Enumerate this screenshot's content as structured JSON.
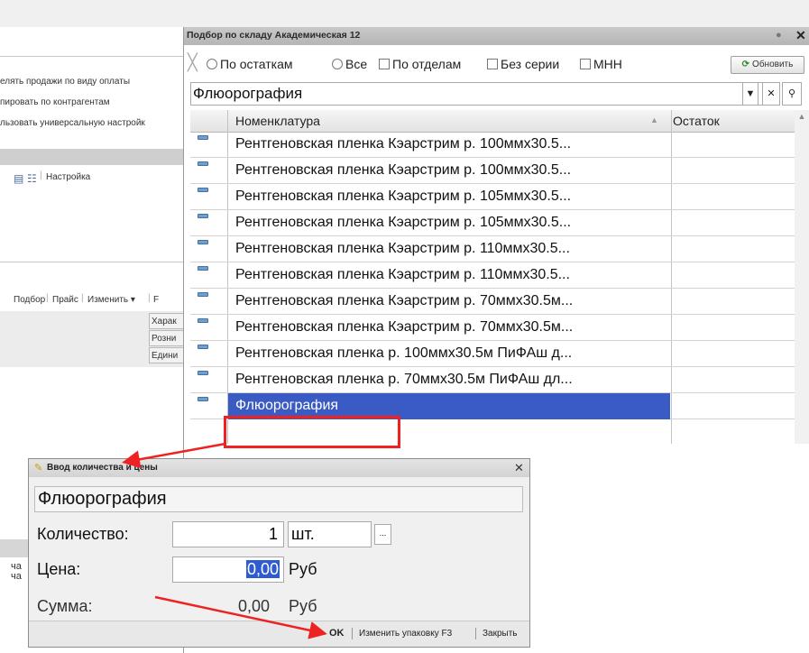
{
  "left_panel": {
    "options": [
      "елять продажи по виду оплаты",
      "пировать по контрагентам",
      "льзовать универсальную настройк"
    ],
    "toolbar_label": "Настройка",
    "toolbar2": {
      "picker": "Подбор",
      "price": "Прайс",
      "change": "Изменить ▾",
      "cut": "F"
    },
    "col_headers": [
      "Харак",
      "Розни",
      "Едини"
    ],
    "bottom_labels": [
      "ча",
      "ча"
    ]
  },
  "picker": {
    "title": "Подбор по складу Академическая 12",
    "pin_icon": "pin-icon",
    "close_glyph": "✕",
    "filters": {
      "by_stock": "По остаткам",
      "all": "Все",
      "by_department": "По отделам",
      "no_series": "Без серии",
      "mnn": "МНН"
    },
    "refresh_label": "Обновить",
    "search_value": "Флюорография",
    "columns": {
      "name": "Номенклатура",
      "rest": "Остаток"
    },
    "rows": [
      {
        "name": "Рентгеновская пленка Кэарстрим р. 100ммx30.5..."
      },
      {
        "name": "Рентгеновская пленка Кэарстрим р. 100ммx30.5..."
      },
      {
        "name": "Рентгеновская пленка Кэарстрим р. 105ммx30.5..."
      },
      {
        "name": "Рентгеновская пленка Кэарстрим р. 105ммx30.5..."
      },
      {
        "name": "Рентгеновская пленка Кэарстрим р. 110ммx30.5..."
      },
      {
        "name": "Рентгеновская пленка Кэарстрим р. 110ммx30.5..."
      },
      {
        "name": "Рентгеновская пленка Кэарстрим р. 70ммx30.5м..."
      },
      {
        "name": "Рентгеновская пленка Кэарстрим р. 70ммx30.5м..."
      },
      {
        "name": "Рентгеновская пленка р. 100ммx30.5м ПиФАш д..."
      },
      {
        "name": "Рентгеновская пленка р. 70ммx30.5м ПиФАш дл..."
      }
    ],
    "selected_row": "Флюорография"
  },
  "dialog": {
    "title": "Ввод количества и цены",
    "close_glyph": "✕",
    "item_name": "Флюорография",
    "qty_label": "Количество:",
    "qty_value": "1",
    "unit_value": "шт.",
    "unit_btn": "...",
    "price_label": "Цена:",
    "price_value": "0,00",
    "price_unit": "Руб",
    "sum_label": "Сумма:",
    "sum_value": "0,00",
    "sum_unit": "Руб",
    "ok_label": "OK",
    "change_pack_label": "Изменить упаковку F3",
    "close_label": "Закрыть"
  },
  "colors": {
    "selection": "#3a5bc3",
    "annotation_red": "#e22222"
  }
}
